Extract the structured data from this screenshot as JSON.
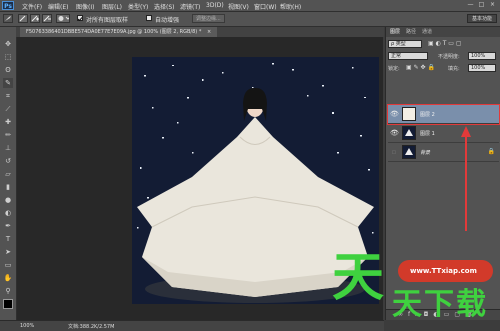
{
  "app": {
    "logo": "Ps"
  },
  "menu": {
    "items": [
      "文件(F)",
      "编辑(E)",
      "图像(I)",
      "图层(L)",
      "类型(Y)",
      "选择(S)",
      "滤镜(T)",
      "3D(D)",
      "视图(V)",
      "窗口(W)",
      "帮助(H)"
    ]
  },
  "window_controls": [
    "—",
    "□",
    "×"
  ],
  "options": {
    "checkbox1_label": "对所有图层取样",
    "checkbox1_checked": true,
    "checkbox2_label": "自动增强",
    "checkbox2_checked": false,
    "refine_button": "调整边缘...",
    "workspace": "基本功能"
  },
  "document": {
    "tab_label": "F50763386401DBBE574DA0E77E7E09A.jpg @ 100% (图层 2, RGB/8) *",
    "close": "×"
  },
  "status": {
    "zoom": "100%",
    "doc_size": "文档:388.2K/2.57M"
  },
  "panel": {
    "tabs": [
      "图层",
      "路径",
      "通道"
    ],
    "filter_kind": "ρ 类型",
    "blend_mode": "正常",
    "opacity_label": "不透明度:",
    "opacity_value": "100%",
    "lock_label": "锁定:",
    "fill_label": "填充:",
    "fill_value": "100%",
    "layers": [
      {
        "name": "图层 2",
        "visible": true,
        "selected": true,
        "locked": false
      },
      {
        "name": "图层 1",
        "visible": true,
        "selected": false,
        "locked": false
      },
      {
        "name": "背景",
        "visible": false,
        "selected": false,
        "locked": true
      }
    ],
    "bottom_icons": [
      "∞",
      "fx",
      "◘",
      "◐",
      "▭",
      "▢",
      "🗑"
    ]
  },
  "watermark": {
    "chars": [
      "天",
      "天",
      "下",
      "载"
    ],
    "url": "www.TTxiap.com"
  },
  "colors": {
    "accent_red": "#e23a3a",
    "selected_layer": "#7a8fab",
    "watermark_green": "#3fd13f",
    "image_bg": "#131c34"
  }
}
